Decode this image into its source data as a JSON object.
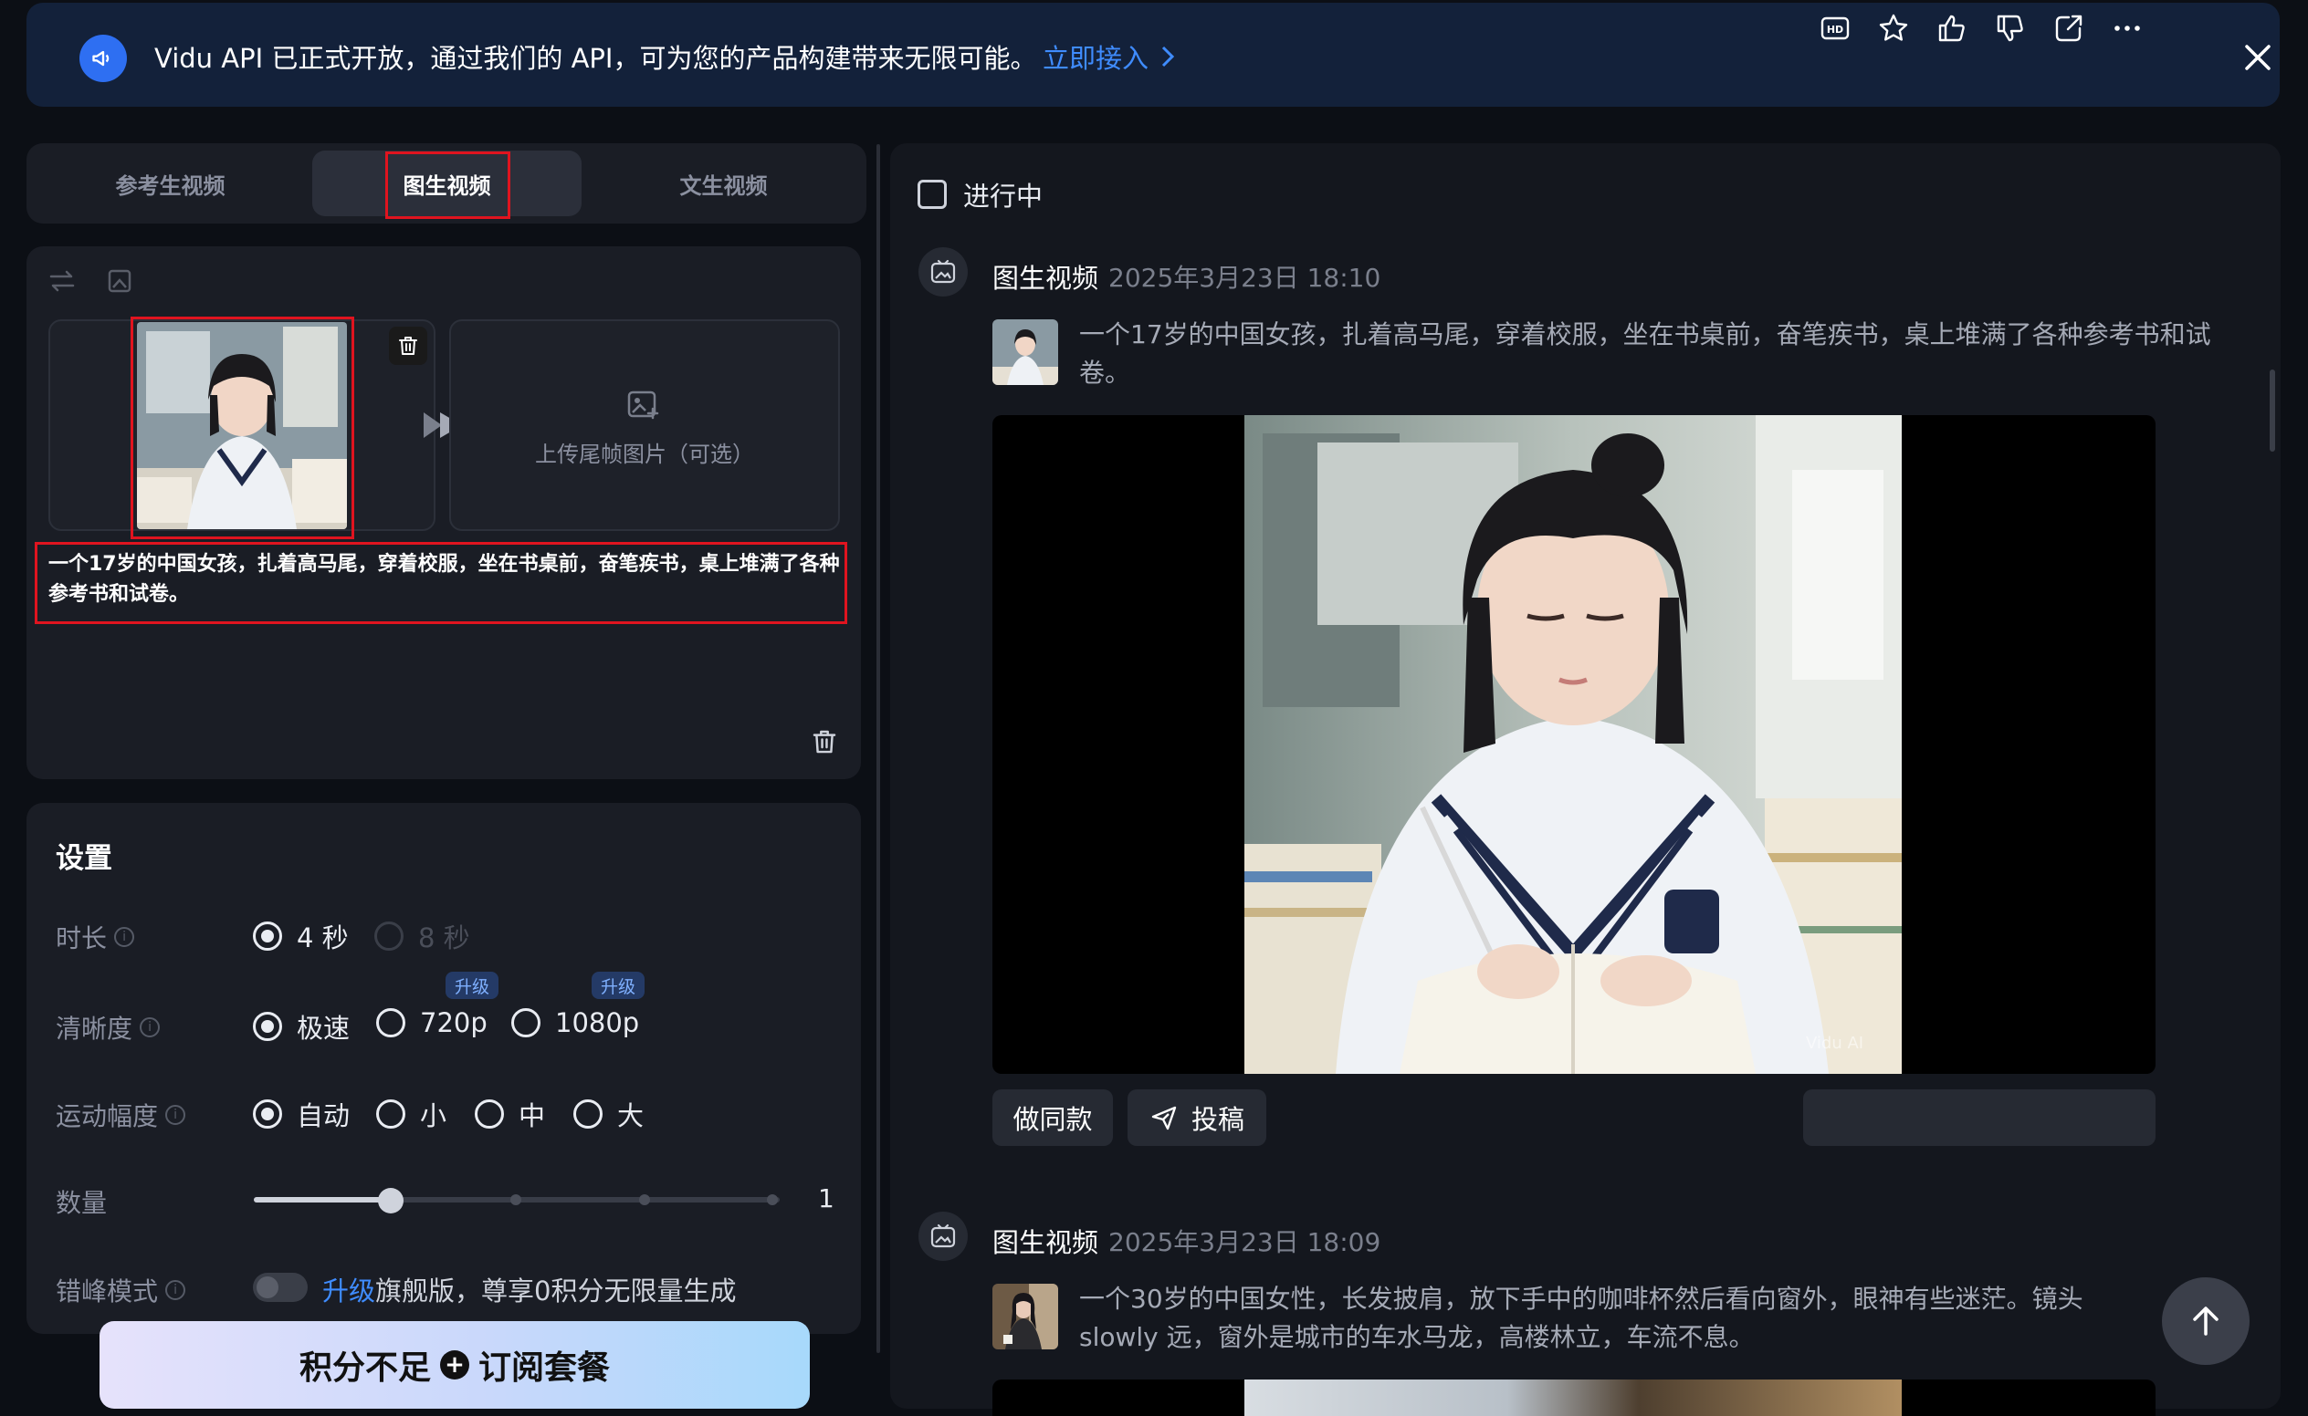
{
  "banner": {
    "text": "Vidu API 已正式开放，通过我们的 API，可为您的产品构建带来无限可能。",
    "link": "立即接入",
    "icon": "megaphone-icon",
    "accent": "#3f8cff"
  },
  "tabs": [
    {
      "label": "参考生视频"
    },
    {
      "label": "图生视频",
      "active": true
    },
    {
      "label": "文生视频"
    }
  ],
  "editor": {
    "upload_label": "上传尾帧图片（可选）",
    "prompt": "一个17岁的中国女孩，扎着高马尾，穿着校服，坐在书桌前，奋笔疾书，桌上堆满了各种参考书和试卷。"
  },
  "settings": {
    "title": "设置",
    "duration": {
      "label": "时长",
      "options": [
        "4 秒",
        "8 秒"
      ],
      "selected": "4 秒"
    },
    "resolution": {
      "label": "清晰度",
      "options": [
        "极速",
        "720p",
        "1080p"
      ],
      "selected": "极速",
      "badge": "升级"
    },
    "motion": {
      "label": "运动幅度",
      "options": [
        "自动",
        "小",
        "中",
        "大"
      ],
      "selected": "自动"
    },
    "quantity": {
      "label": "数量",
      "value": "1"
    },
    "off_peak": {
      "label": "错峰模式",
      "upgrade": "升级",
      "text": "旗舰版，尊享0积分无限量生成",
      "enabled": false
    }
  },
  "subscribe": {
    "left": "积分不足",
    "right": "订阅套餐"
  },
  "feed": {
    "in_progress_label": "进行中",
    "tasks": [
      {
        "type": "图生视频",
        "time": "2025年3月23日 18:10",
        "prompt": "一个17岁的中国女孩，扎着高马尾，穿着校服，坐在书桌前，奋笔疾书，桌上堆满了各种参考书和试卷。",
        "watermark": "Vidu AI"
      },
      {
        "type": "图生视频",
        "time": "2025年3月23日 18:09",
        "prompt": "一个30岁的中国女性，长发披肩，放下手中的咖啡杯然后看向窗外，眼神有些迷茫。镜头 slowly 远，窗外是城市的车水马龙，高楼林立，车流不息。"
      }
    ],
    "actions": {
      "same_style": "做同款",
      "submit": "投稿"
    }
  }
}
